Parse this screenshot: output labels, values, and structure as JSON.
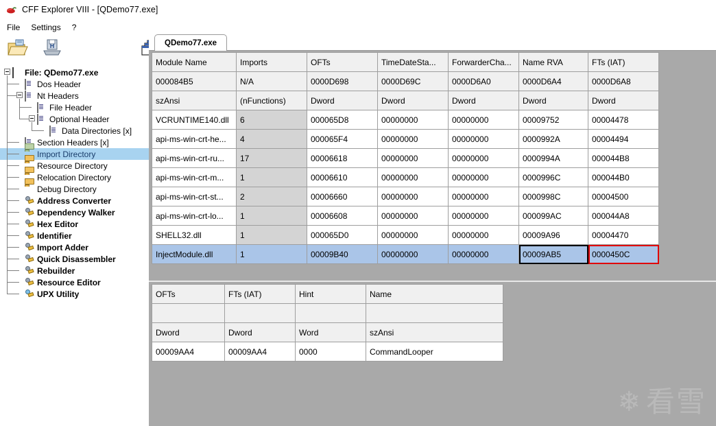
{
  "window": {
    "title": "CFF Explorer VIII - [QDemo77.exe]",
    "icon": "chili-pepper-icon"
  },
  "menu": {
    "items": [
      {
        "label": "File"
      },
      {
        "label": "Settings"
      },
      {
        "label": "?"
      }
    ]
  },
  "toolbar": {
    "buttons": [
      {
        "name": "open-file-button",
        "icon": "open-folder-icon"
      },
      {
        "name": "save-file-button",
        "icon": "save-disk-icon"
      },
      {
        "name": "cascade-windows-button",
        "icon": "windows-cascade-icon"
      }
    ]
  },
  "sidebar": {
    "items": [
      {
        "label": "File: QDemo77.exe",
        "icon": "window-icon",
        "depth": 0,
        "bold": true,
        "selected": false,
        "expander": true
      },
      {
        "label": "Dos Header",
        "icon": "page-icon",
        "depth": 1,
        "bold": false,
        "selected": false,
        "expander": false
      },
      {
        "label": "Nt Headers",
        "icon": "page-icon",
        "depth": 1,
        "bold": false,
        "selected": false,
        "expander": true
      },
      {
        "label": "File Header",
        "icon": "page-icon",
        "depth": 2,
        "bold": false,
        "selected": false,
        "expander": false
      },
      {
        "label": "Optional Header",
        "icon": "page-icon",
        "depth": 2,
        "bold": false,
        "selected": false,
        "expander": true
      },
      {
        "label": "Data Directories [x]",
        "icon": "page-icon",
        "depth": 3,
        "bold": false,
        "selected": false,
        "expander": false
      },
      {
        "label": "Section Headers [x]",
        "icon": "page-icon",
        "depth": 1,
        "bold": false,
        "selected": false,
        "expander": false
      },
      {
        "label": "Import Directory",
        "icon": "folder-green-icon",
        "depth": 1,
        "bold": false,
        "selected": true,
        "expander": false
      },
      {
        "label": "Resource Directory",
        "icon": "folder-icon",
        "depth": 1,
        "bold": false,
        "selected": false,
        "expander": false
      },
      {
        "label": "Relocation Directory",
        "icon": "folder-icon",
        "depth": 1,
        "bold": false,
        "selected": false,
        "expander": false
      },
      {
        "label": "Debug Directory",
        "icon": "folder-icon",
        "depth": 1,
        "bold": false,
        "selected": false,
        "expander": false
      },
      {
        "label": "Address Converter",
        "icon": "tool-icon",
        "depth": 1,
        "bold": true,
        "selected": false,
        "expander": false
      },
      {
        "label": "Dependency Walker",
        "icon": "tool-icon",
        "depth": 1,
        "bold": true,
        "selected": false,
        "expander": false
      },
      {
        "label": "Hex Editor",
        "icon": "tool-icon",
        "depth": 1,
        "bold": true,
        "selected": false,
        "expander": false
      },
      {
        "label": "Identifier",
        "icon": "tool-icon",
        "depth": 1,
        "bold": true,
        "selected": false,
        "expander": false
      },
      {
        "label": "Import Adder",
        "icon": "tool-icon",
        "depth": 1,
        "bold": true,
        "selected": false,
        "expander": false
      },
      {
        "label": "Quick Disassembler",
        "icon": "tool-icon",
        "depth": 1,
        "bold": true,
        "selected": false,
        "expander": false
      },
      {
        "label": "Rebuilder",
        "icon": "tool-icon",
        "depth": 1,
        "bold": true,
        "selected": false,
        "expander": false
      },
      {
        "label": "Resource Editor",
        "icon": "tool-icon",
        "depth": 1,
        "bold": true,
        "selected": false,
        "expander": false
      },
      {
        "label": "UPX Utility",
        "icon": "tool-blue-icon",
        "depth": 1,
        "bold": true,
        "selected": false,
        "expander": false
      }
    ]
  },
  "tabs": [
    {
      "label": "QDemo77.exe",
      "active": true
    }
  ],
  "import_table": {
    "headers": [
      "Module Name",
      "Imports",
      "OFTs",
      "TimeDateSta...",
      "ForwarderCha...",
      "Name RVA",
      "FTs (IAT)"
    ],
    "meta_rows": [
      [
        "000084B5",
        "N/A",
        "0000D698",
        "0000D69C",
        "0000D6A0",
        "0000D6A4",
        "0000D6A8"
      ],
      [
        "szAnsi",
        "(nFunctions)",
        "Dword",
        "Dword",
        "Dword",
        "Dword",
        "Dword"
      ]
    ],
    "rows": [
      {
        "cells": [
          "VCRUNTIME140.dll",
          "6",
          "000065D8",
          "00000000",
          "00000000",
          "00009752",
          "00004478"
        ],
        "selected": false
      },
      {
        "cells": [
          "api-ms-win-crt-he...",
          "4",
          "000065F4",
          "00000000",
          "00000000",
          "0000992A",
          "00004494"
        ],
        "selected": false
      },
      {
        "cells": [
          "api-ms-win-crt-ru...",
          "17",
          "00006618",
          "00000000",
          "00000000",
          "0000994A",
          "000044B8"
        ],
        "selected": false
      },
      {
        "cells": [
          "api-ms-win-crt-m...",
          "1",
          "00006610",
          "00000000",
          "00000000",
          "0000996C",
          "000044B0"
        ],
        "selected": false
      },
      {
        "cells": [
          "api-ms-win-crt-st...",
          "2",
          "00006660",
          "00000000",
          "00000000",
          "0000998C",
          "00004500"
        ],
        "selected": false
      },
      {
        "cells": [
          "api-ms-win-crt-lo...",
          "1",
          "00006608",
          "00000000",
          "00000000",
          "000099AC",
          "000044A8"
        ],
        "selected": false
      },
      {
        "cells": [
          "SHELL32.dll",
          "1",
          "000065D0",
          "00000000",
          "00000000",
          "00009A96",
          "00004470"
        ],
        "selected": false
      },
      {
        "cells": [
          "InjectModule.dll",
          "1",
          "00009B40",
          "00000000",
          "00000000",
          "00009AB5",
          "0000450C"
        ],
        "selected": true,
        "highlight_black": 5,
        "highlight_red": 6
      }
    ]
  },
  "thunk_table": {
    "headers": [
      "OFTs",
      "FTs (IAT)",
      "Hint",
      "Name"
    ],
    "meta_rows": [
      [
        "",
        "",
        "",
        ""
      ],
      [
        "Dword",
        "Dword",
        "Word",
        "szAnsi"
      ]
    ],
    "rows": [
      {
        "cells": [
          "00009AA4",
          "00009AA4",
          "0000",
          "CommandLooper"
        ]
      }
    ]
  },
  "watermark": {
    "flake": "❄",
    "text": "看雪"
  },
  "colors": {
    "selection": "#aac5e8",
    "tree_selection": "#a8d3f0",
    "highlight_red": "#e00000",
    "client_background": "#a9a9a9"
  }
}
